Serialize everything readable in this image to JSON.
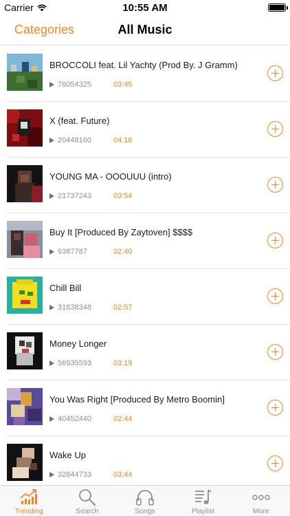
{
  "status": {
    "carrier": "Carrier",
    "time": "10:55 AM"
  },
  "nav": {
    "left_label": "Categories",
    "title": "All Music"
  },
  "colors": {
    "accent": "#f0852c",
    "inactive": "#8e8e8e"
  },
  "songs": [
    {
      "title": "BROCCOLI feat. Lil Yachty (Prod By. J Gramm)",
      "plays": "76054325",
      "duration": "03:45"
    },
    {
      "title": "X (feat. Future)",
      "plays": "20448160",
      "duration": "04:18"
    },
    {
      "title": "YOUNG MA - OOOUUU (intro)",
      "plays": "21737243",
      "duration": "03:54"
    },
    {
      "title": "Buy It  [Produced By Zaytoven] $$$$",
      "plays": "9387787",
      "duration": "02:40"
    },
    {
      "title": "Chill Bill",
      "plays": "31638348",
      "duration": "02:57"
    },
    {
      "title": "Money Longer",
      "plays": "56935593",
      "duration": "03:19"
    },
    {
      "title": "You Was Right [Produced By Metro Boomin]",
      "plays": "40452440",
      "duration": "02:44"
    },
    {
      "title": "Wake Up",
      "plays": "32844733",
      "duration": "03:44"
    }
  ],
  "tabs": [
    {
      "label": "Trending",
      "icon": "trending-icon",
      "active": true
    },
    {
      "label": "Search",
      "icon": "search-icon",
      "active": false
    },
    {
      "label": "Songs",
      "icon": "headphones-icon",
      "active": false
    },
    {
      "label": "Playlist",
      "icon": "playlist-icon",
      "active": false
    },
    {
      "label": "More",
      "icon": "more-icon",
      "active": false
    }
  ]
}
